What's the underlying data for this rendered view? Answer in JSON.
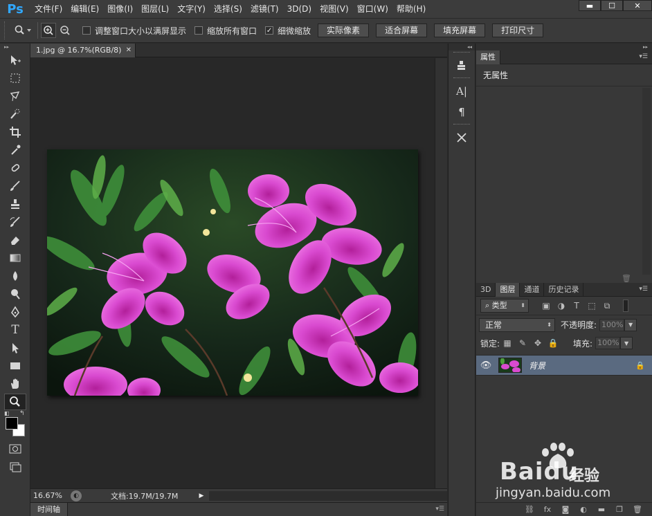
{
  "app": {
    "logo": "Ps"
  },
  "menu": [
    "文件(F)",
    "编辑(E)",
    "图像(I)",
    "图层(L)",
    "文字(Y)",
    "选择(S)",
    "滤镜(T)",
    "3D(D)",
    "视图(V)",
    "窗口(W)",
    "帮助(H)"
  ],
  "options": {
    "resize_windows_label": "调整窗口大小以满屏显示",
    "resize_windows_checked": false,
    "zoom_all_label": "缩放所有窗口",
    "zoom_all_checked": false,
    "scrubby_label": "细微缩放",
    "scrubby_checked": true,
    "buttons": [
      "实际像素",
      "适合屏幕",
      "填充屏幕",
      "打印尺寸"
    ]
  },
  "document": {
    "tab_title": "1.jpg @ 16.7%(RGB/8)",
    "zoom": "16.67%",
    "doc_info": "文档:19.7M/19.7M"
  },
  "timeline": {
    "label": "时间轴"
  },
  "properties": {
    "tab": "属性",
    "empty_text": "无属性"
  },
  "layers_panel": {
    "tabs": [
      "3D",
      "图层",
      "通道",
      "历史记录"
    ],
    "active_tab": "图层",
    "filter_kind": "类型",
    "blend_mode": "正常",
    "opacity_label": "不透明度:",
    "opacity_value": "100%",
    "lock_label": "锁定:",
    "fill_label": "填充:",
    "fill_value": "100%",
    "layers": [
      {
        "name": "背景",
        "visible": true,
        "locked": true
      }
    ]
  },
  "watermark": {
    "brand": "Bai",
    "brand2": "du",
    "sub": "经验",
    "url": "jingyan.baidu.com"
  },
  "colors": {
    "foreground": "#000000",
    "background": "#ffffff",
    "selected_layer": "#5a6a80",
    "ps_blue": "#31a8ff"
  }
}
